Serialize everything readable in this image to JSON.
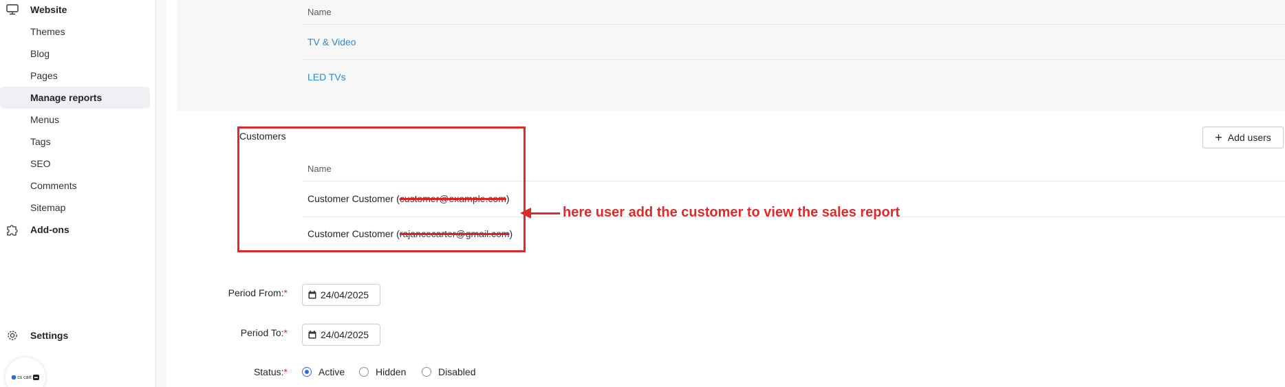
{
  "sidebar": {
    "website": {
      "label": "Website",
      "icon": "monitor-icon"
    },
    "items": [
      {
        "label": "Themes"
      },
      {
        "label": "Blog"
      },
      {
        "label": "Pages"
      },
      {
        "label": "Manage reports",
        "active": true
      },
      {
        "label": "Menus"
      },
      {
        "label": "Tags"
      },
      {
        "label": "SEO"
      },
      {
        "label": "Comments"
      },
      {
        "label": "Sitemap"
      }
    ],
    "addons": {
      "label": "Add-ons",
      "icon": "puzzle-icon"
    },
    "settings": {
      "label": "Settings",
      "icon": "gear-icon"
    },
    "logo_text": "cs cart"
  },
  "categories": {
    "column_header": "Name",
    "rows": [
      {
        "label": "TV & Video"
      },
      {
        "label": "LED TVs"
      }
    ]
  },
  "customers": {
    "title": "Customers",
    "add_button": "Add users",
    "column_header": "Name",
    "rows": [
      {
        "name": "Customer Customer (",
        "email": "customer@example.com",
        "close": ")"
      },
      {
        "name": "Customer Customer (",
        "email": "rajancecarter@gmail.com",
        "close": ")"
      }
    ]
  },
  "annotation": "here user add the customer to view the sales report",
  "form": {
    "period_from_label": "Period From:",
    "period_from_value": "24/04/2025",
    "period_to_label": "Period To:",
    "period_to_value": "24/04/2025",
    "status_label": "Status:",
    "required_mark": "*",
    "status_options": [
      {
        "label": "Active",
        "checked": true
      },
      {
        "label": "Hidden",
        "checked": false
      },
      {
        "label": "Disabled",
        "checked": false
      }
    ]
  },
  "colors": {
    "accent": "#2d6cdf",
    "link": "#2b8ac8",
    "annotation": "#e02a2a"
  }
}
